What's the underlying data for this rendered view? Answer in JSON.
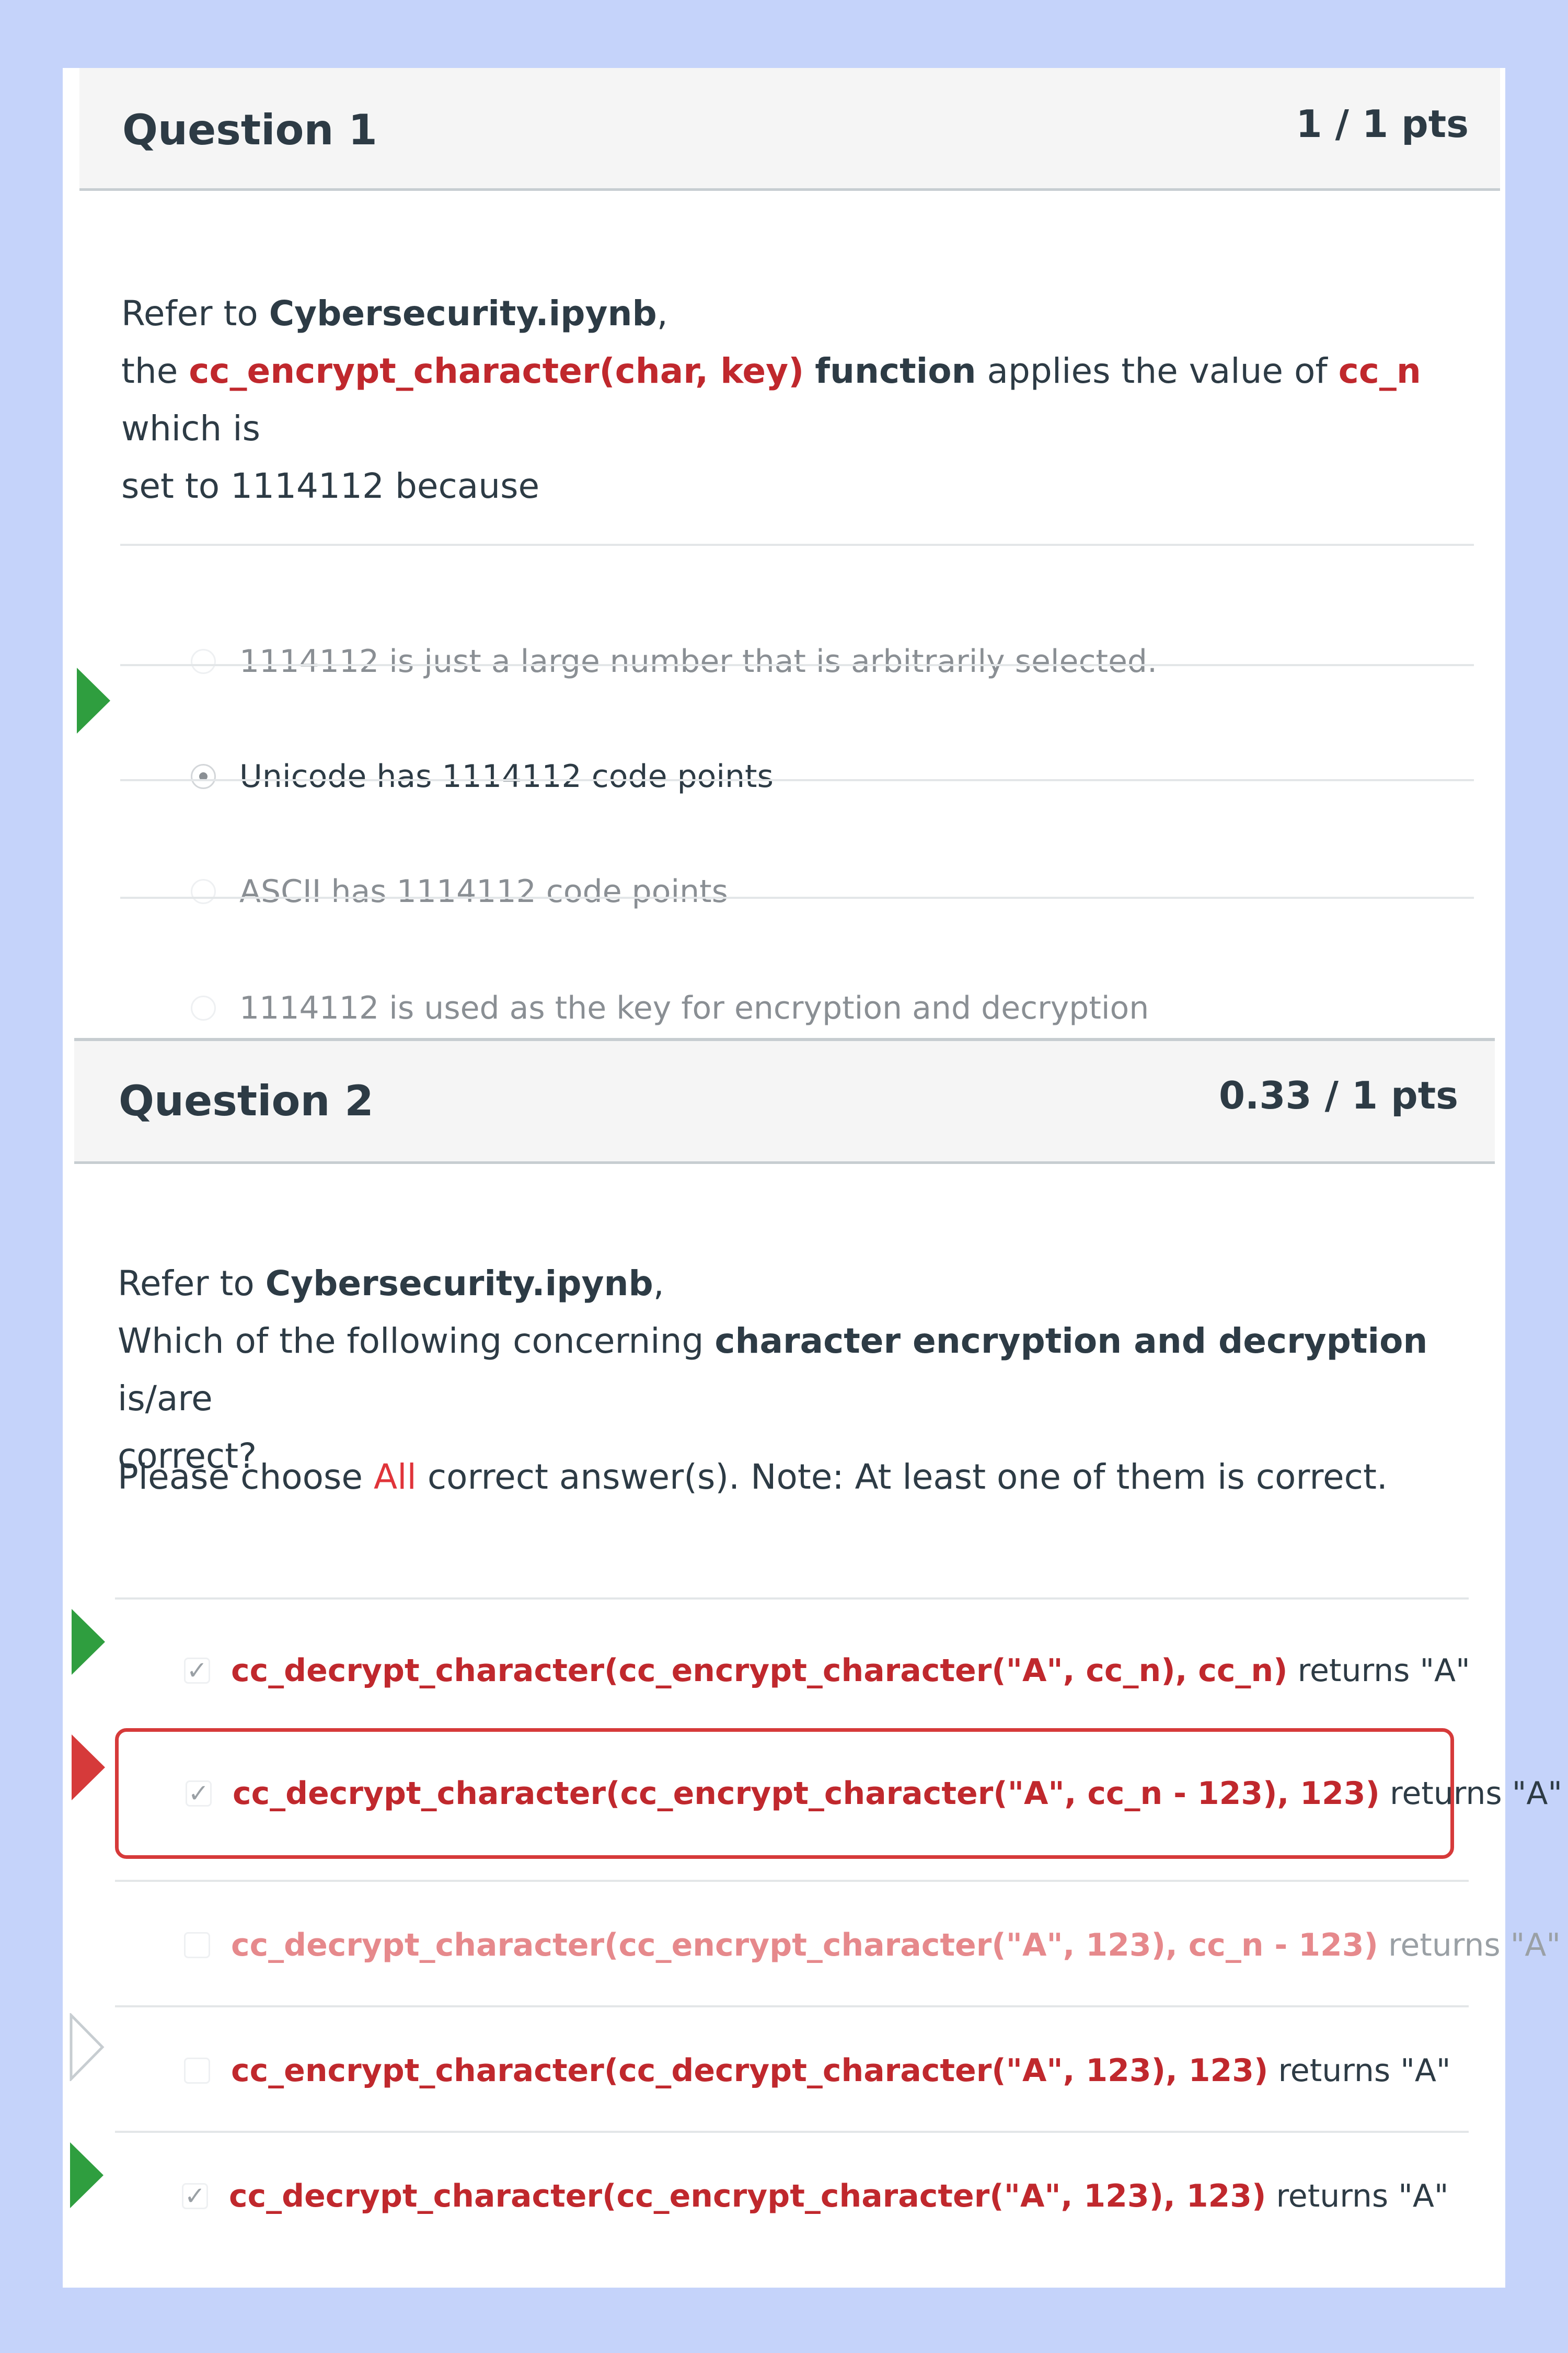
{
  "page": {
    "background": "#c5d3fa"
  },
  "q1": {
    "title": "Question 1",
    "points": "1 / 1 pts",
    "text": {
      "prefix": "Refer to ",
      "file": "Cybersecurity.ipynb",
      "comma": ",",
      "line2_the": "the ",
      "func": "cc_encrypt_character(char, key)",
      "func_word": "function",
      "mid": " applies the value of ",
      "var": "cc_n",
      "tail1": " which is",
      "tail2": "set to 1114112 because"
    },
    "answers": [
      {
        "label": "1114112 is just a large number that is arbitrarily selected.",
        "selected": false
      },
      {
        "label": "Unicode has 1114112 code points",
        "selected": true
      },
      {
        "label": "ASCII has 1114112 code points",
        "selected": false
      },
      {
        "label": "1114112 is used as the key for encryption and decryption",
        "selected": false
      }
    ]
  },
  "q2": {
    "title": "Question 2",
    "points": "0.33 / 1 pts",
    "text": {
      "prefix": "Refer to ",
      "file": "Cybersecurity.ipynb",
      "comma": ",",
      "line2": "Which of the following concerning ",
      "bold": "character encryption and decryption",
      "line2_tail": " is/are",
      "line3": "correct?",
      "note_a": "Please choose ",
      "note_all": "All",
      "note_b": " correct answer(s).  Note: At least one of them is correct."
    },
    "answers": [
      {
        "code": "cc_decrypt_character(cc_encrypt_character(\"A\", cc_n), cc_n)",
        "tail": " returns \"A\"",
        "checked": true,
        "flag": "correct"
      },
      {
        "code": "cc_decrypt_character(cc_encrypt_character(\"A\", cc_n - 123), 123)",
        "tail": " returns \"A\"",
        "checked": true,
        "flag": "incorrect"
      },
      {
        "code": "cc_decrypt_character(cc_encrypt_character(\"A\", 123), cc_n - 123)",
        "tail": " returns \"A\"",
        "checked": false,
        "flag": "none"
      },
      {
        "code": "cc_encrypt_character(cc_decrypt_character(\"A\", 123), 123)",
        "tail": " returns \"A\"",
        "checked": false,
        "flag": "missed"
      },
      {
        "code": "cc_decrypt_character(cc_encrypt_character(\"A\", 123), 123)",
        "tail": "  returns \"A\"",
        "checked": true,
        "flag": "correct"
      }
    ]
  },
  "icons": {
    "check": "✓",
    "correct_flag": "green-arrow",
    "incorrect_flag": "red-arrow",
    "missed_flag": "white-arrow"
  },
  "colors": {
    "correct": "#2f9e3f",
    "incorrect": "#d63a3a",
    "accent_red": "#c0282d"
  }
}
